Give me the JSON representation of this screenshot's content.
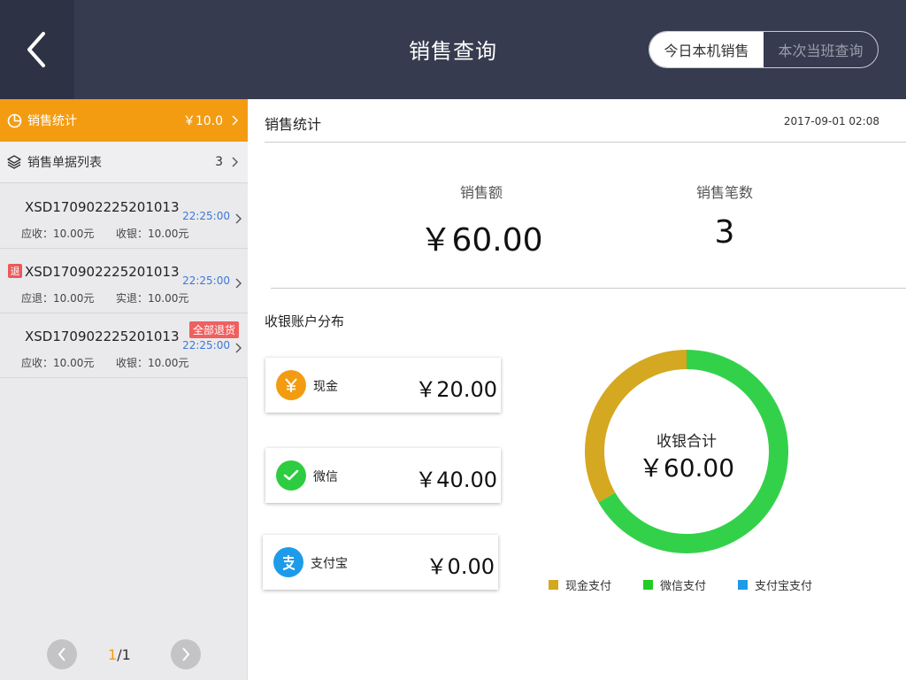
{
  "header": {
    "title": "销售查询",
    "tabs": [
      {
        "label": "今日本机销售",
        "active": true
      },
      {
        "label": "本次当班查询",
        "active": false
      }
    ]
  },
  "sidebar": {
    "menu": [
      {
        "label": "销售统计",
        "value": "￥10.0",
        "icon": "pie-chart-icon",
        "active": true
      },
      {
        "label": "销售单据列表",
        "value": "3",
        "icon": "layers-icon",
        "active": false
      }
    ],
    "orders": [
      {
        "id": "XSD170902225201013",
        "time": "22:25:00",
        "left_label": "应收：10.00元",
        "right_label": "收银：10.00元",
        "refund_badge": "",
        "full_refund_badge": ""
      },
      {
        "id": "XSD170902225201013",
        "time": "22:25:00",
        "left_label": "应退：10.00元",
        "right_label": "实退：10.00元",
        "refund_badge": "退",
        "full_refund_badge": ""
      },
      {
        "id": "XSD170902225201013",
        "time": "22:25:00",
        "left_label": "应收：10.00元",
        "right_label": "收银：10.00元",
        "refund_badge": "",
        "full_refund_badge": "全部退货"
      }
    ],
    "pager": {
      "current": "1",
      "total": "/1"
    }
  },
  "main": {
    "title": "销售统计",
    "date": "2017-09-01 02:08",
    "stats": [
      {
        "label": "销售额",
        "value": "￥60.00"
      },
      {
        "label": "销售笔数",
        "value": "3"
      }
    ],
    "distribution_title": "收银账户分布",
    "payments": [
      {
        "name": "现金",
        "amount": "￥20.00",
        "icon": "yuan-icon",
        "color": "#f39c12"
      },
      {
        "name": "微信",
        "amount": "￥40.00",
        "icon": "wechat-icon",
        "color": "#2ecc40"
      },
      {
        "name": "支付宝",
        "amount": "￥0.00",
        "icon": "alipay-icon",
        "color": "#1e9be8"
      }
    ],
    "donut": {
      "label": "收银合计",
      "value": "￥60.00"
    },
    "legend": [
      {
        "label": "现金支付",
        "color": "#d4a820"
      },
      {
        "label": "微信支付",
        "color": "#22cc22"
      },
      {
        "label": "支付宝支付",
        "color": "#1e9be8"
      }
    ]
  },
  "chart_data": {
    "type": "pie",
    "categories": [
      "现金支付",
      "微信支付",
      "支付宝支付"
    ],
    "values": [
      20,
      40,
      0
    ],
    "colors": [
      "#d4a820",
      "#33d14a",
      "#1e9be8"
    ],
    "title": "",
    "center_label": "收银合计",
    "center_value": "￥60.00",
    "legend_position": "bottom"
  }
}
